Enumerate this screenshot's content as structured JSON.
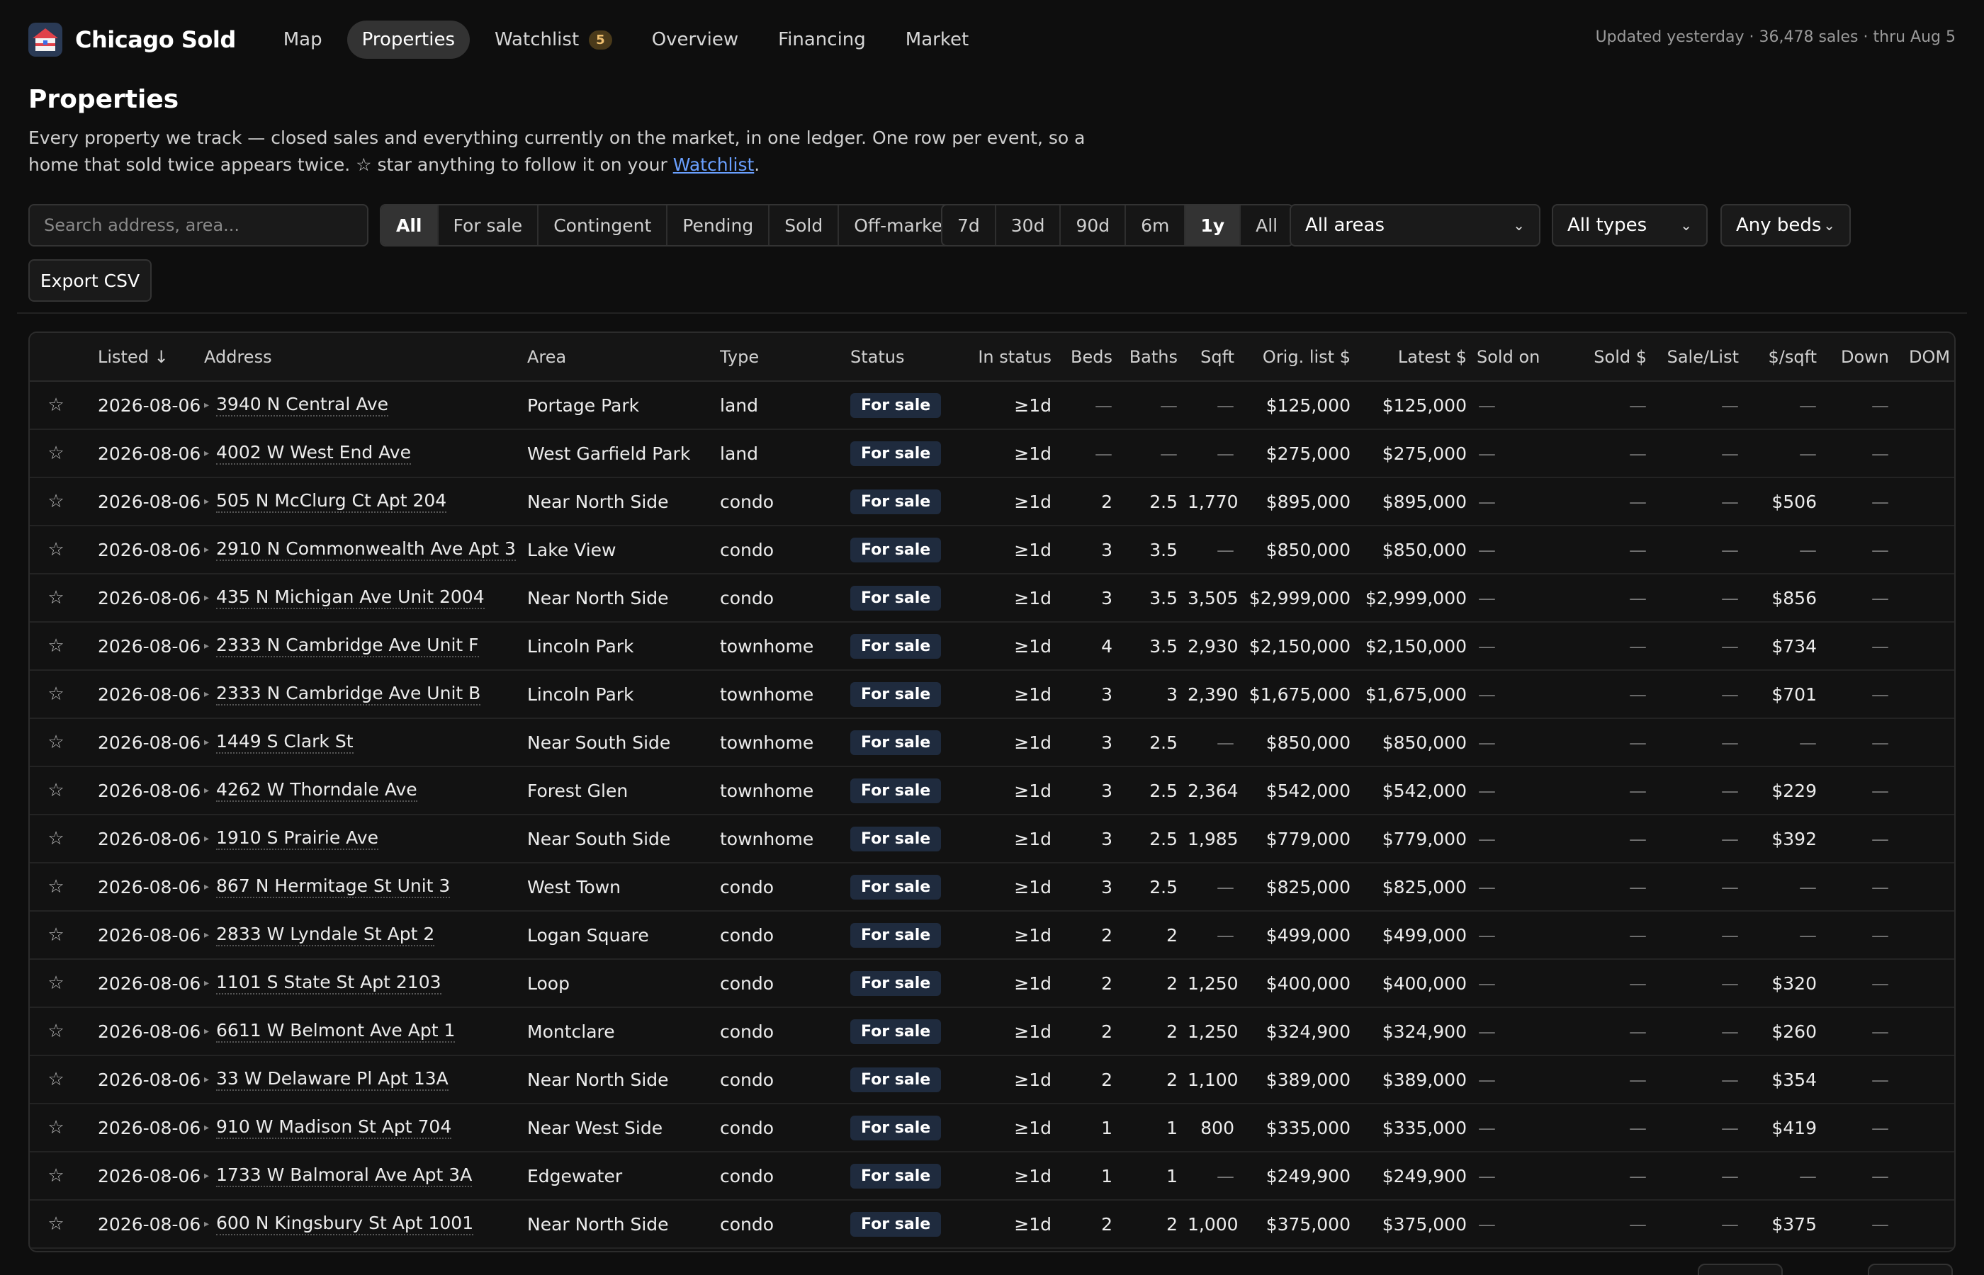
{
  "app": {
    "name": "Chicago Sold",
    "updated": "Updated yesterday · 36,478 sales · thru Aug 5"
  },
  "nav": {
    "map": "Map",
    "properties": "Properties",
    "watchlist": "Watchlist",
    "watchlist_count": "5",
    "overview": "Overview",
    "financing": "Financing",
    "market": "Market"
  },
  "page": {
    "title": "Properties",
    "intro_text": "Every property we track — closed sales and everything currently on the market, in one ledger. One row per event, so a home that sold twice appears twice. ☆ star anything to follow it on your ",
    "intro_link": "Watchlist",
    "intro_end": "."
  },
  "filters": {
    "search_placeholder": "Search address, area...",
    "status": [
      "All",
      "For sale",
      "Contingent",
      "Pending",
      "Sold",
      "Off-market"
    ],
    "status_selected": "All",
    "range": [
      "7d",
      "30d",
      "90d",
      "6m",
      "1y",
      "All"
    ],
    "range_selected": "1y",
    "area": "All areas",
    "type": "All types",
    "beds": "Any beds",
    "export": "Export CSV"
  },
  "table": {
    "columns": [
      "",
      "Listed ↓",
      "Address",
      "Area",
      "Type",
      "Status",
      "In status",
      "Beds",
      "Baths",
      "Sqft",
      "Orig. list $",
      "Latest $",
      "Sold on",
      "Sold $",
      "Sale/List",
      "$/sqft",
      "Down",
      "DOM"
    ],
    "rows": [
      {
        "listed": "2026-08-06",
        "address": "3940 N Central Ave",
        "area": "Portage Park",
        "type": "land",
        "status": "For sale",
        "in_status": "≥1d",
        "beds": "—",
        "baths": "—",
        "sqft": "—",
        "orig": "$125,000",
        "latest": "$125,000",
        "sold_on": "—",
        "sold": "—",
        "sale_list": "—",
        "ppsf": "—",
        "down": "—"
      },
      {
        "listed": "2026-08-06",
        "address": "4002 W West End Ave",
        "area": "West Garfield Park",
        "type": "land",
        "status": "For sale",
        "in_status": "≥1d",
        "beds": "—",
        "baths": "—",
        "sqft": "—",
        "orig": "$275,000",
        "latest": "$275,000",
        "sold_on": "—",
        "sold": "—",
        "sale_list": "—",
        "ppsf": "—",
        "down": "—"
      },
      {
        "listed": "2026-08-06",
        "address": "505 N McClurg Ct Apt 204",
        "area": "Near North Side",
        "type": "condo",
        "status": "For sale",
        "in_status": "≥1d",
        "beds": "2",
        "baths": "2.5",
        "sqft": "1,770",
        "orig": "$895,000",
        "latest": "$895,000",
        "sold_on": "—",
        "sold": "—",
        "sale_list": "—",
        "ppsf": "$506",
        "down": "—"
      },
      {
        "listed": "2026-08-06",
        "address": "2910 N Commonwealth Ave Apt 3",
        "area": "Lake View",
        "type": "condo",
        "status": "For sale",
        "in_status": "≥1d",
        "beds": "3",
        "baths": "3.5",
        "sqft": "—",
        "orig": "$850,000",
        "latest": "$850,000",
        "sold_on": "—",
        "sold": "—",
        "sale_list": "—",
        "ppsf": "—",
        "down": "—"
      },
      {
        "listed": "2026-08-06",
        "address": "435 N Michigan Ave Unit 2004",
        "area": "Near North Side",
        "type": "condo",
        "status": "For sale",
        "in_status": "≥1d",
        "beds": "3",
        "baths": "3.5",
        "sqft": "3,505",
        "orig": "$2,999,000",
        "latest": "$2,999,000",
        "sold_on": "—",
        "sold": "—",
        "sale_list": "—",
        "ppsf": "$856",
        "down": "—"
      },
      {
        "listed": "2026-08-06",
        "address": "2333 N Cambridge Ave Unit F",
        "area": "Lincoln Park",
        "type": "townhome",
        "status": "For sale",
        "in_status": "≥1d",
        "beds": "4",
        "baths": "3.5",
        "sqft": "2,930",
        "orig": "$2,150,000",
        "latest": "$2,150,000",
        "sold_on": "—",
        "sold": "—",
        "sale_list": "—",
        "ppsf": "$734",
        "down": "—"
      },
      {
        "listed": "2026-08-06",
        "address": "2333 N Cambridge Ave Unit B",
        "area": "Lincoln Park",
        "type": "townhome",
        "status": "For sale",
        "in_status": "≥1d",
        "beds": "3",
        "baths": "3",
        "sqft": "2,390",
        "orig": "$1,675,000",
        "latest": "$1,675,000",
        "sold_on": "—",
        "sold": "—",
        "sale_list": "—",
        "ppsf": "$701",
        "down": "—"
      },
      {
        "listed": "2026-08-06",
        "address": "1449 S Clark St",
        "area": "Near South Side",
        "type": "townhome",
        "status": "For sale",
        "in_status": "≥1d",
        "beds": "3",
        "baths": "2.5",
        "sqft": "—",
        "orig": "$850,000",
        "latest": "$850,000",
        "sold_on": "—",
        "sold": "—",
        "sale_list": "—",
        "ppsf": "—",
        "down": "—"
      },
      {
        "listed": "2026-08-06",
        "address": "4262 W Thorndale Ave",
        "area": "Forest Glen",
        "type": "townhome",
        "status": "For sale",
        "in_status": "≥1d",
        "beds": "3",
        "baths": "2.5",
        "sqft": "2,364",
        "orig": "$542,000",
        "latest": "$542,000",
        "sold_on": "—",
        "sold": "—",
        "sale_list": "—",
        "ppsf": "$229",
        "down": "—"
      },
      {
        "listed": "2026-08-06",
        "address": "1910 S Prairie Ave",
        "area": "Near South Side",
        "type": "townhome",
        "status": "For sale",
        "in_status": "≥1d",
        "beds": "3",
        "baths": "2.5",
        "sqft": "1,985",
        "orig": "$779,000",
        "latest": "$779,000",
        "sold_on": "—",
        "sold": "—",
        "sale_list": "—",
        "ppsf": "$392",
        "down": "—"
      },
      {
        "listed": "2026-08-06",
        "address": "867 N Hermitage St Unit 3",
        "area": "West Town",
        "type": "condo",
        "status": "For sale",
        "in_status": "≥1d",
        "beds": "3",
        "baths": "2.5",
        "sqft": "—",
        "orig": "$825,000",
        "latest": "$825,000",
        "sold_on": "—",
        "sold": "—",
        "sale_list": "—",
        "ppsf": "—",
        "down": "—"
      },
      {
        "listed": "2026-08-06",
        "address": "2833 W Lyndale St Apt 2",
        "area": "Logan Square",
        "type": "condo",
        "status": "For sale",
        "in_status": "≥1d",
        "beds": "2",
        "baths": "2",
        "sqft": "—",
        "orig": "$499,000",
        "latest": "$499,000",
        "sold_on": "—",
        "sold": "—",
        "sale_list": "—",
        "ppsf": "—",
        "down": "—"
      },
      {
        "listed": "2026-08-06",
        "address": "1101 S State St Apt 2103",
        "area": "Loop",
        "type": "condo",
        "status": "For sale",
        "in_status": "≥1d",
        "beds": "2",
        "baths": "2",
        "sqft": "1,250",
        "orig": "$400,000",
        "latest": "$400,000",
        "sold_on": "—",
        "sold": "—",
        "sale_list": "—",
        "ppsf": "$320",
        "down": "—"
      },
      {
        "listed": "2026-08-06",
        "address": "6611 W Belmont Ave Apt 1",
        "area": "Montclare",
        "type": "condo",
        "status": "For sale",
        "in_status": "≥1d",
        "beds": "2",
        "baths": "2",
        "sqft": "1,250",
        "orig": "$324,900",
        "latest": "$324,900",
        "sold_on": "—",
        "sold": "—",
        "sale_list": "—",
        "ppsf": "$260",
        "down": "—"
      },
      {
        "listed": "2026-08-06",
        "address": "33 W Delaware Pl Apt 13A",
        "area": "Near North Side",
        "type": "condo",
        "status": "For sale",
        "in_status": "≥1d",
        "beds": "2",
        "baths": "2",
        "sqft": "1,100",
        "orig": "$389,000",
        "latest": "$389,000",
        "sold_on": "—",
        "sold": "—",
        "sale_list": "—",
        "ppsf": "$354",
        "down": "—"
      },
      {
        "listed": "2026-08-06",
        "address": "910 W Madison St Apt 704",
        "area": "Near West Side",
        "type": "condo",
        "status": "For sale",
        "in_status": "≥1d",
        "beds": "1",
        "baths": "1",
        "sqft": "800",
        "orig": "$335,000",
        "latest": "$335,000",
        "sold_on": "—",
        "sold": "—",
        "sale_list": "—",
        "ppsf": "$419",
        "down": "—"
      },
      {
        "listed": "2026-08-06",
        "address": "1733 W Balmoral Ave Apt 3A",
        "area": "Edgewater",
        "type": "condo",
        "status": "For sale",
        "in_status": "≥1d",
        "beds": "1",
        "baths": "1",
        "sqft": "—",
        "orig": "$249,900",
        "latest": "$249,900",
        "sold_on": "—",
        "sold": "—",
        "sale_list": "—",
        "ppsf": "—",
        "down": "—"
      },
      {
        "listed": "2026-08-06",
        "address": "600 N Kingsbury St Apt 1001",
        "area": "Near North Side",
        "type": "condo",
        "status": "For sale",
        "in_status": "≥1d",
        "beds": "2",
        "baths": "2",
        "sqft": "1,000",
        "orig": "$375,000",
        "latest": "$375,000",
        "sold_on": "—",
        "sold": "—",
        "sale_list": "—",
        "ppsf": "$375",
        "down": "—"
      }
    ]
  },
  "icons": {
    "star": "star-outline-icon",
    "row_caret": "caret-right-icon",
    "dropdown": "chevron-down-icon"
  },
  "colors": {
    "background": "#0e0e0e",
    "status_pill": "#1f2b3e",
    "link": "#6aa0ff",
    "badge": "#4a3a1a"
  }
}
